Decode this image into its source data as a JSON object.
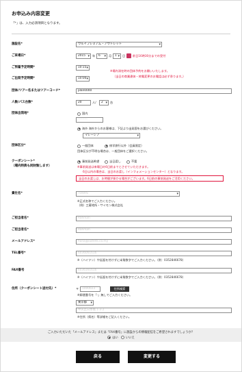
{
  "page": {
    "title": "お申込み内容変更",
    "note": "「*」は、入力必須項目となります。"
  },
  "hotel": {
    "label": "施設名*",
    "value": "ウルイプレミアム・アウトレット"
  },
  "checkin": {
    "label": "ご来場日*",
    "year": "2015",
    "year_unit": "年",
    "month": "6",
    "month_unit": "月",
    "day": "1",
    "day_unit": "日",
    "note": "前日16時30分までの受付"
  },
  "arrival": {
    "label": "ご到着予定時間*",
    "value": "10:15"
  },
  "depart": {
    "label": "ご出発予定時間*",
    "value": "10:00"
  },
  "time_note": [
    "※場内滞在時の団体予約をお願いいたします。",
    "（当日の商業違体・終電変更のお電話は必ず承ります。）"
  ],
  "tour": {
    "label": "団体/ツアー名またはツアーコード*",
    "value": "plan0000"
  },
  "people": {
    "label": "人数/バス台数*",
    "count": "20",
    "count_unit": "人/",
    "buses": "2",
    "bus_unit": "台"
  },
  "origin": {
    "label": "団体出発地*",
    "options": [
      "国内",
      "海外 海外からのお客様は、下記より出発国をお選びください。"
    ],
    "selected": 1,
    "domestic_value": "---------",
    "country": "マレーシア"
  },
  "category": {
    "label": "団体区分*",
    "options": [
      "一般団体",
      "修学旅行以外（会員限定）"
    ],
    "selected": 1,
    "note": "団体区分が不明な場合は、一般団体をご選択ください。"
  },
  "coupon": {
    "label": "クーポンシート*",
    "sublabel": "（場内特典も同封致します）",
    "options": [
      "事前発送希望",
      "当日渡し",
      "不要"
    ],
    "selected": 0,
    "notes": [
      "※事前発送は来場日の6日前までとさせていただきます。",
      "6日以内の場合は、当日のお渡し（インフォメーションセンター）となります。"
    ],
    "warning": "当日のお渡しは、お時間が掛かる場合がございます。6日前の事前発送をご活用ください。"
  },
  "company": {
    "label": "貴社名*",
    "value": "TOURS",
    "note_lines": [
      "※正式名称でご入力ください。",
      "（例）三菱地所・サイモン株式会社"
    ]
  },
  "contact": {
    "label": "ご担当者名*",
    "value": "Rahmah"
  },
  "contact2": {
    "label": "ご担当者名*",
    "value": "Rahmah"
  },
  "email": {
    "label": "メールアドレス*",
    "value": "fiona@outlets.co.my"
  },
  "tel": {
    "label": "TEL番号*",
    "value": "6036061616",
    "note": "※（ハイフン）や括弧を付けずに半角数字でご入力ください。（例：0352846678）"
  },
  "fax": {
    "label": "FAX番号",
    "value": "6036161616",
    "note": "※（ハイフン）や括弧を付けずに半角数字でご入力ください。（例：0352846678）"
  },
  "address": {
    "label": "住所（クーポンシート送付先）*",
    "zip_prefix": "〒",
    "zip": "1000023",
    "search_btn": "住所検索",
    "zip_note": "※郵便番号を「-」無しでご入力ください。",
    "pref": "東京都",
    "street": "中央区日本橋 1-3-2",
    "street_note": "※住所（県名）等詳細をご記入ください。"
  },
  "newsletter": {
    "question": "ご入力いただいた「メールアドレス」または「FAX番号」に施設からの情報配信をご希望されますでしょうか？",
    "options": [
      "はい",
      "いいえ"
    ],
    "selected": 0
  },
  "buttons": {
    "back": "戻る",
    "submit": "変更する"
  }
}
